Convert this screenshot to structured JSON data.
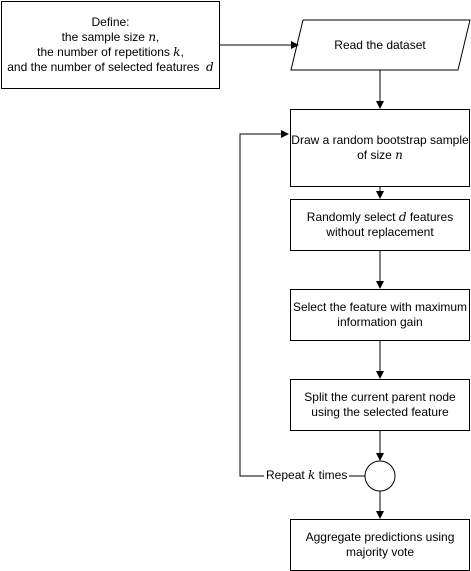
{
  "nodes": {
    "define": {
      "lines": [
        [
          {
            "t": "Define:"
          }
        ],
        [
          {
            "t": "the sample size "
          },
          {
            "m": "n"
          },
          {
            "t": ","
          }
        ],
        [
          {
            "t": "the number of repetitions "
          },
          {
            "m": "k"
          },
          {
            "t": ","
          }
        ],
        [
          {
            "t": "and the number of selected features  "
          },
          {
            "m": "d"
          }
        ]
      ]
    },
    "read_dataset": {
      "text": "Read the dataset"
    },
    "bootstrap": {
      "lines": [
        [
          {
            "t": "Draw a random bootstrap sample"
          }
        ],
        [
          {
            "t": "of size "
          },
          {
            "m": "n"
          }
        ]
      ]
    },
    "select_features": {
      "lines": [
        [
          {
            "t": "Randomly select "
          },
          {
            "m": "d"
          },
          {
            "t": " features"
          }
        ],
        [
          {
            "t": "without replacement"
          }
        ]
      ]
    },
    "max_gain": {
      "lines": [
        [
          {
            "t": "Select the feature with maximum"
          }
        ],
        [
          {
            "t": "information gain"
          }
        ]
      ]
    },
    "split": {
      "lines": [
        [
          {
            "t": "Split the current parent node"
          }
        ],
        [
          {
            "t": "using the selected feature"
          }
        ]
      ]
    },
    "aggregate": {
      "lines": [
        [
          {
            "t": "Aggregate predictions using"
          }
        ],
        [
          {
            "t": "majority vote"
          }
        ]
      ]
    }
  },
  "loop": {
    "prefix": "Repeat ",
    "var": "k",
    "suffix": " times"
  }
}
